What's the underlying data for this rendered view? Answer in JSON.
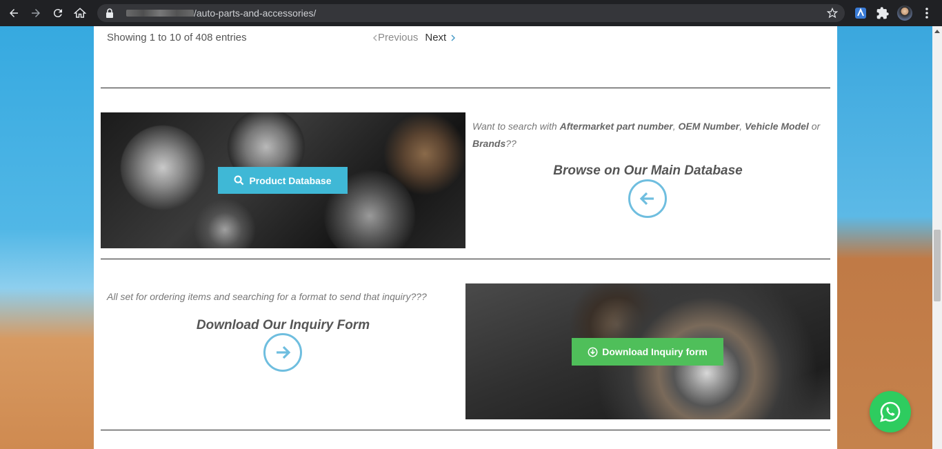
{
  "browser": {
    "url_path": "/auto-parts-and-accessories/"
  },
  "table_footer": {
    "showing": "Showing 1 to 10 of 408 entries",
    "previous": "Previous",
    "next": "Next"
  },
  "database_section": {
    "intro_prefix": "Want to search with ",
    "term1": "Aftermarket part number",
    "sep1": ", ",
    "term2": "OEM Number",
    "sep2": ", ",
    "term3": "Vehicle Model",
    "sep3": " or ",
    "term4": "Brands",
    "suffix": "??",
    "heading": "Browse on Our Main Database",
    "button_label": "Product Database"
  },
  "inquiry_section": {
    "intro": "All set for ordering items and searching for a format to send that inquiry???",
    "heading": "Download Our Inquiry Form",
    "button_label": "Download Inquiry form"
  },
  "colors": {
    "product_button": "#3fb8d6",
    "download_button": "#4fbf5a",
    "arrow_circle": "#6fbedf",
    "whatsapp": "#2ecc5f"
  }
}
